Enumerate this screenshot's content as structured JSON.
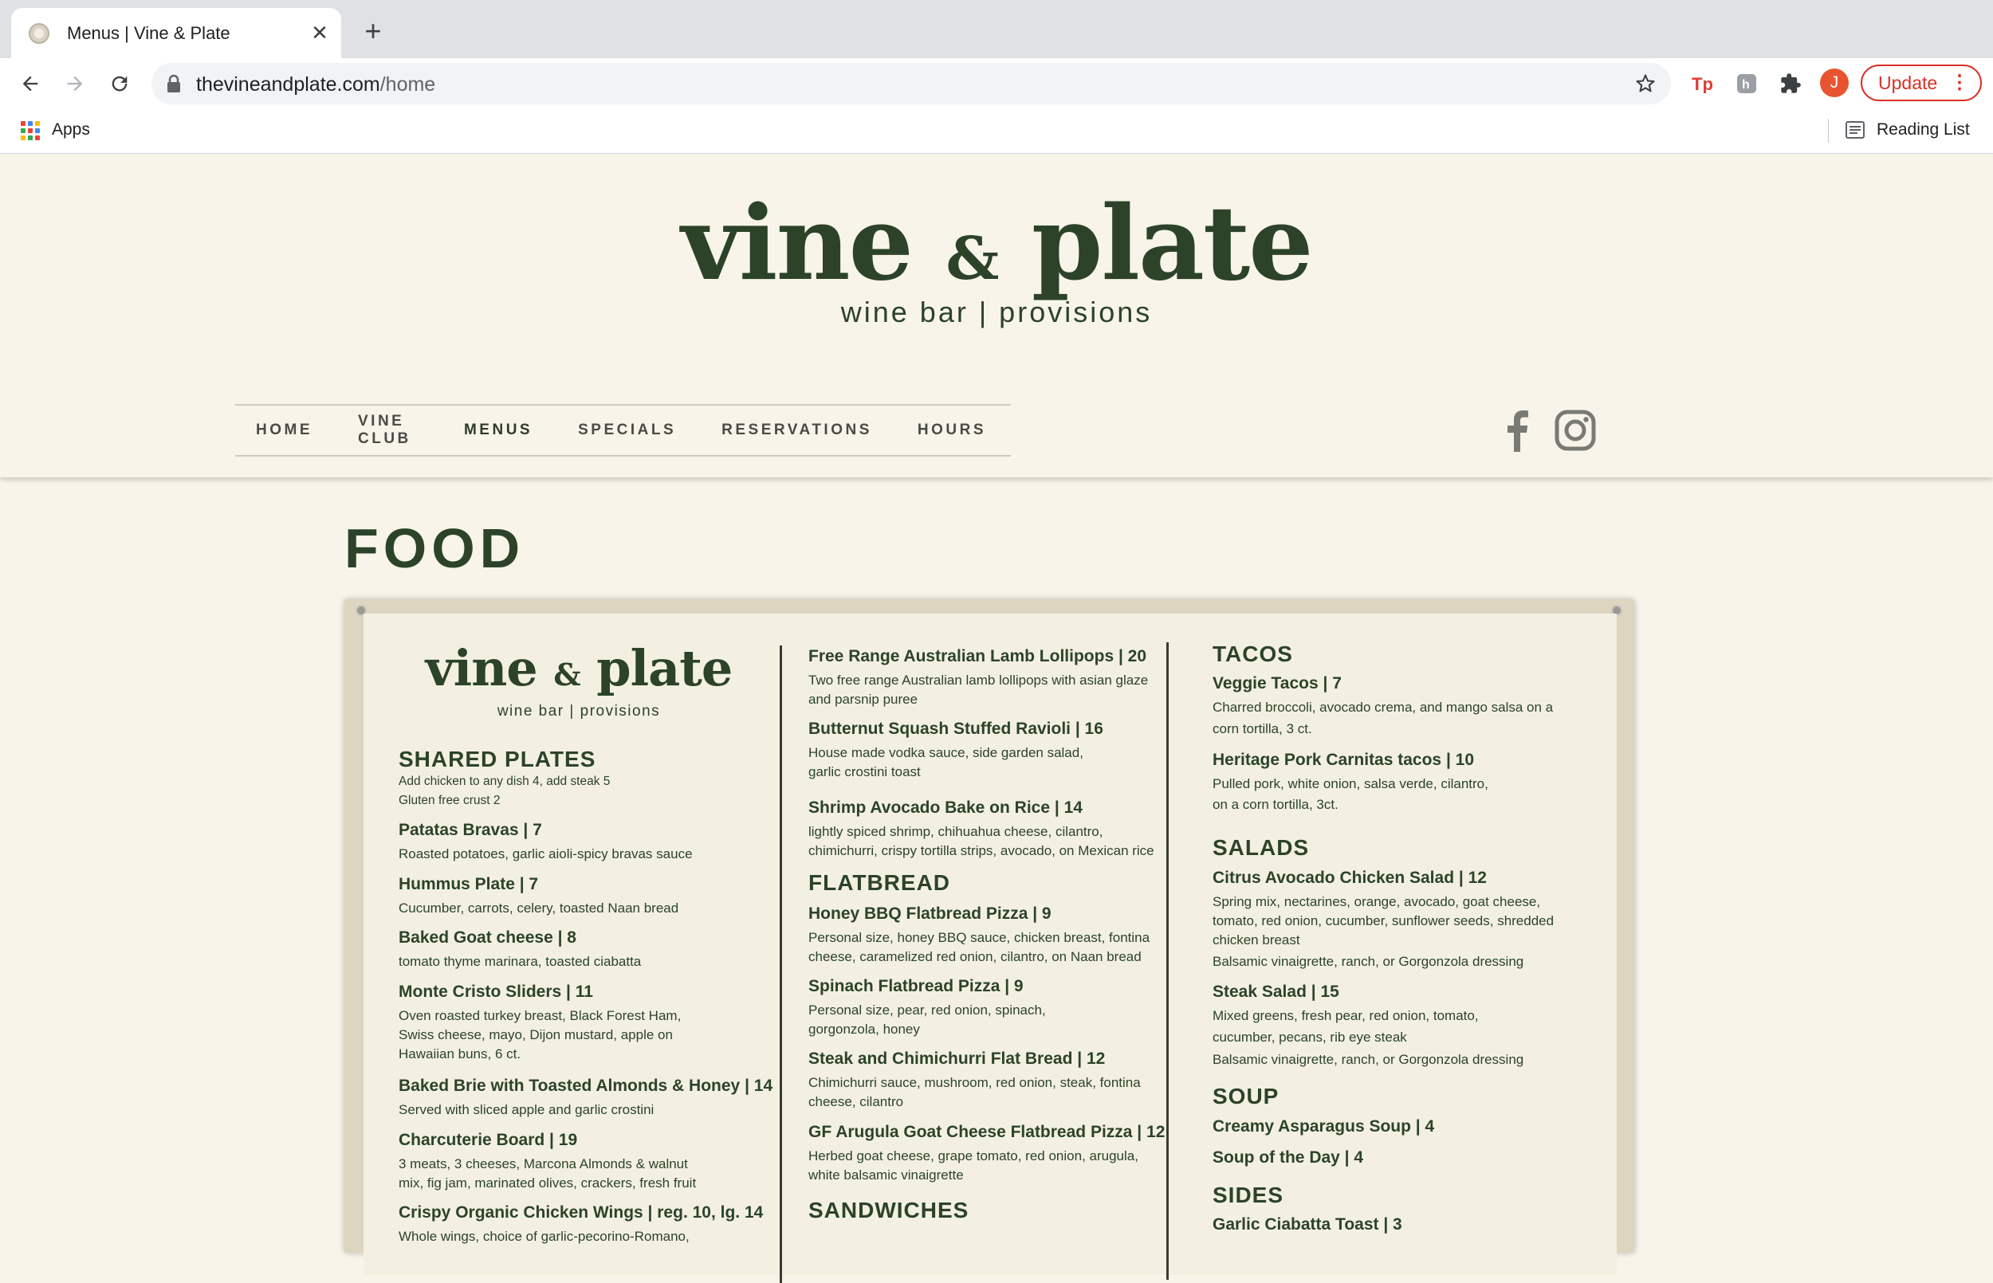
{
  "browser": {
    "tab_title": "Menus | Vine & Plate",
    "url_domain": "thevineandplate.com",
    "url_path": "/home",
    "profile_initial": "J",
    "update_label": "Update",
    "bookmarks": {
      "apps_label": "Apps",
      "reading_list_label": "Reading List"
    },
    "apps_colors": [
      "#ea4335",
      "#4285f4",
      "#fbbc04",
      "#34a853",
      "#ea4335",
      "#4285f4",
      "#fbbc04",
      "#34a853",
      "#ea4335"
    ]
  },
  "site": {
    "logo_word1": "vine",
    "logo_amp": "&",
    "logo_word2": "plate",
    "tagline": "wine bar | provisions",
    "nav": [
      {
        "label": "HOME"
      },
      {
        "label": "VINE CLUB"
      },
      {
        "label": "MENUS"
      },
      {
        "label": "SPECIALS"
      },
      {
        "label": "RESERVATIONS"
      },
      {
        "label": "HOURS"
      }
    ],
    "social_icons": [
      "facebook-icon",
      "instagram-icon"
    ],
    "brand_color": "#2c4329"
  },
  "page": {
    "title": "FOOD",
    "menu": {
      "logo_word1": "vine",
      "logo_amp": "&",
      "logo_word2": "plate",
      "tagline": "wine bar | provisions",
      "shared_plates": {
        "heading": "SHARED PLATES",
        "note1": "Add chicken to any dish 4, add steak 5",
        "note2": "Gluten free crust  2",
        "items": [
          {
            "name": "Patatas Bravas | 7",
            "desc": [
              "Roasted potatoes, garlic aioli-spicy bravas sauce"
            ]
          },
          {
            "name": "Hummus Plate | 7",
            "desc": [
              "Cucumber, carrots, celery, toasted Naan bread"
            ]
          },
          {
            "name": "Baked Goat cheese | 8",
            "desc": [
              "tomato thyme marinara, toasted ciabatta"
            ]
          },
          {
            "name": "Monte Cristo Sliders | 11",
            "desc": [
              "Oven roasted turkey breast, Black Forest Ham,",
              "Swiss cheese, mayo, Dijon mustard, apple on",
              "Hawaiian buns, 6 ct."
            ]
          },
          {
            "name": "Baked Brie with Toasted Almonds & Honey | 14",
            "desc": [
              "Served with sliced apple and garlic crostini"
            ]
          },
          {
            "name": "Charcuterie Board | 19",
            "desc": [
              "3 meats, 3 cheeses, Marcona Almonds & walnut",
              "mix, fig jam, marinated olives, crackers, fresh fruit"
            ]
          },
          {
            "name": "Crispy Organic Chicken Wings | reg. 10, lg. 14",
            "desc": [
              "Whole wings, choice of garlic-pecorino-Romano,"
            ]
          }
        ]
      },
      "col2": {
        "items_top": [
          {
            "name": "Free Range Australian Lamb Lollipops  | 20",
            "desc": [
              "Two free range Australian lamb lollipops with asian glaze",
              "and parsnip puree"
            ]
          },
          {
            "name": "Butternut Squash Stuffed Ravioli | 16",
            "desc": [
              "House made vodka sauce, side garden salad,",
              "garlic crostini toast"
            ]
          },
          {
            "name": "Shrimp Avocado Bake on Rice | 14",
            "desc": [
              "lightly spiced shrimp, chihuahua cheese, cilantro,",
              "chimichurri, crispy tortilla strips, avocado, on Mexican rice"
            ]
          }
        ],
        "flatbread_heading": "FLATBREAD",
        "flatbread": [
          {
            "name": "Honey BBQ Flatbread Pizza | 9",
            "desc": [
              "Personal size, honey BBQ sauce, chicken breast, fontina",
              "cheese, caramelized red onion, cilantro, on Naan bread"
            ]
          },
          {
            "name": "Spinach Flatbread Pizza | 9",
            "desc": [
              "Personal size, pear, red onion, spinach,",
              "gorgonzola, honey"
            ]
          },
          {
            "name": "Steak and Chimichurri Flat Bread | 12",
            "desc": [
              "Chimichurri sauce, mushroom, red onion, steak, fontina",
              "cheese, cilantro"
            ]
          },
          {
            "name": "GF Arugula Goat Cheese Flatbread Pizza | 12",
            "desc": [
              "Herbed goat cheese, grape tomato, red onion, arugula,",
              "white balsamic vinaigrette"
            ]
          }
        ],
        "sandwiches_heading": "SANDWICHES"
      },
      "col3": {
        "tacos_heading": "TACOS",
        "tacos": [
          {
            "name": "Veggie Tacos | 7",
            "desc": [
              "Charred broccoli, avocado crema, and mango salsa on a",
              "corn tortilla, 3 ct."
            ]
          },
          {
            "name": "Heritage Pork Carnitas tacos | 10",
            "desc": [
              "Pulled pork, white onion, salsa verde, cilantro,",
              "on a corn tortilla, 3ct."
            ]
          }
        ],
        "salads_heading": "SALADS",
        "salads": [
          {
            "name": "Citrus Avocado Chicken Salad | 12",
            "desc": [
              "Spring mix, nectarines, orange, avocado, goat cheese,",
              "tomato, red onion, cucumber, sunflower seeds, shredded",
              "chicken breast",
              "Balsamic vinaigrette, ranch, or Gorgonzola dressing"
            ]
          },
          {
            "name": "Steak Salad | 15",
            "desc": [
              "Mixed greens, fresh pear, red onion, tomato,",
              "cucumber, pecans, rib eye steak",
              "Balsamic vinaigrette, ranch, or Gorgonzola dressing"
            ]
          }
        ],
        "soup_heading": "SOUP",
        "soup": [
          {
            "name": "Creamy Asparagus Soup | 4"
          },
          {
            "name": "Soup of the Day | 4"
          }
        ],
        "sides_heading": "SIDES",
        "sides": [
          {
            "name": "Garlic Ciabatta Toast | 3"
          }
        ]
      }
    }
  }
}
